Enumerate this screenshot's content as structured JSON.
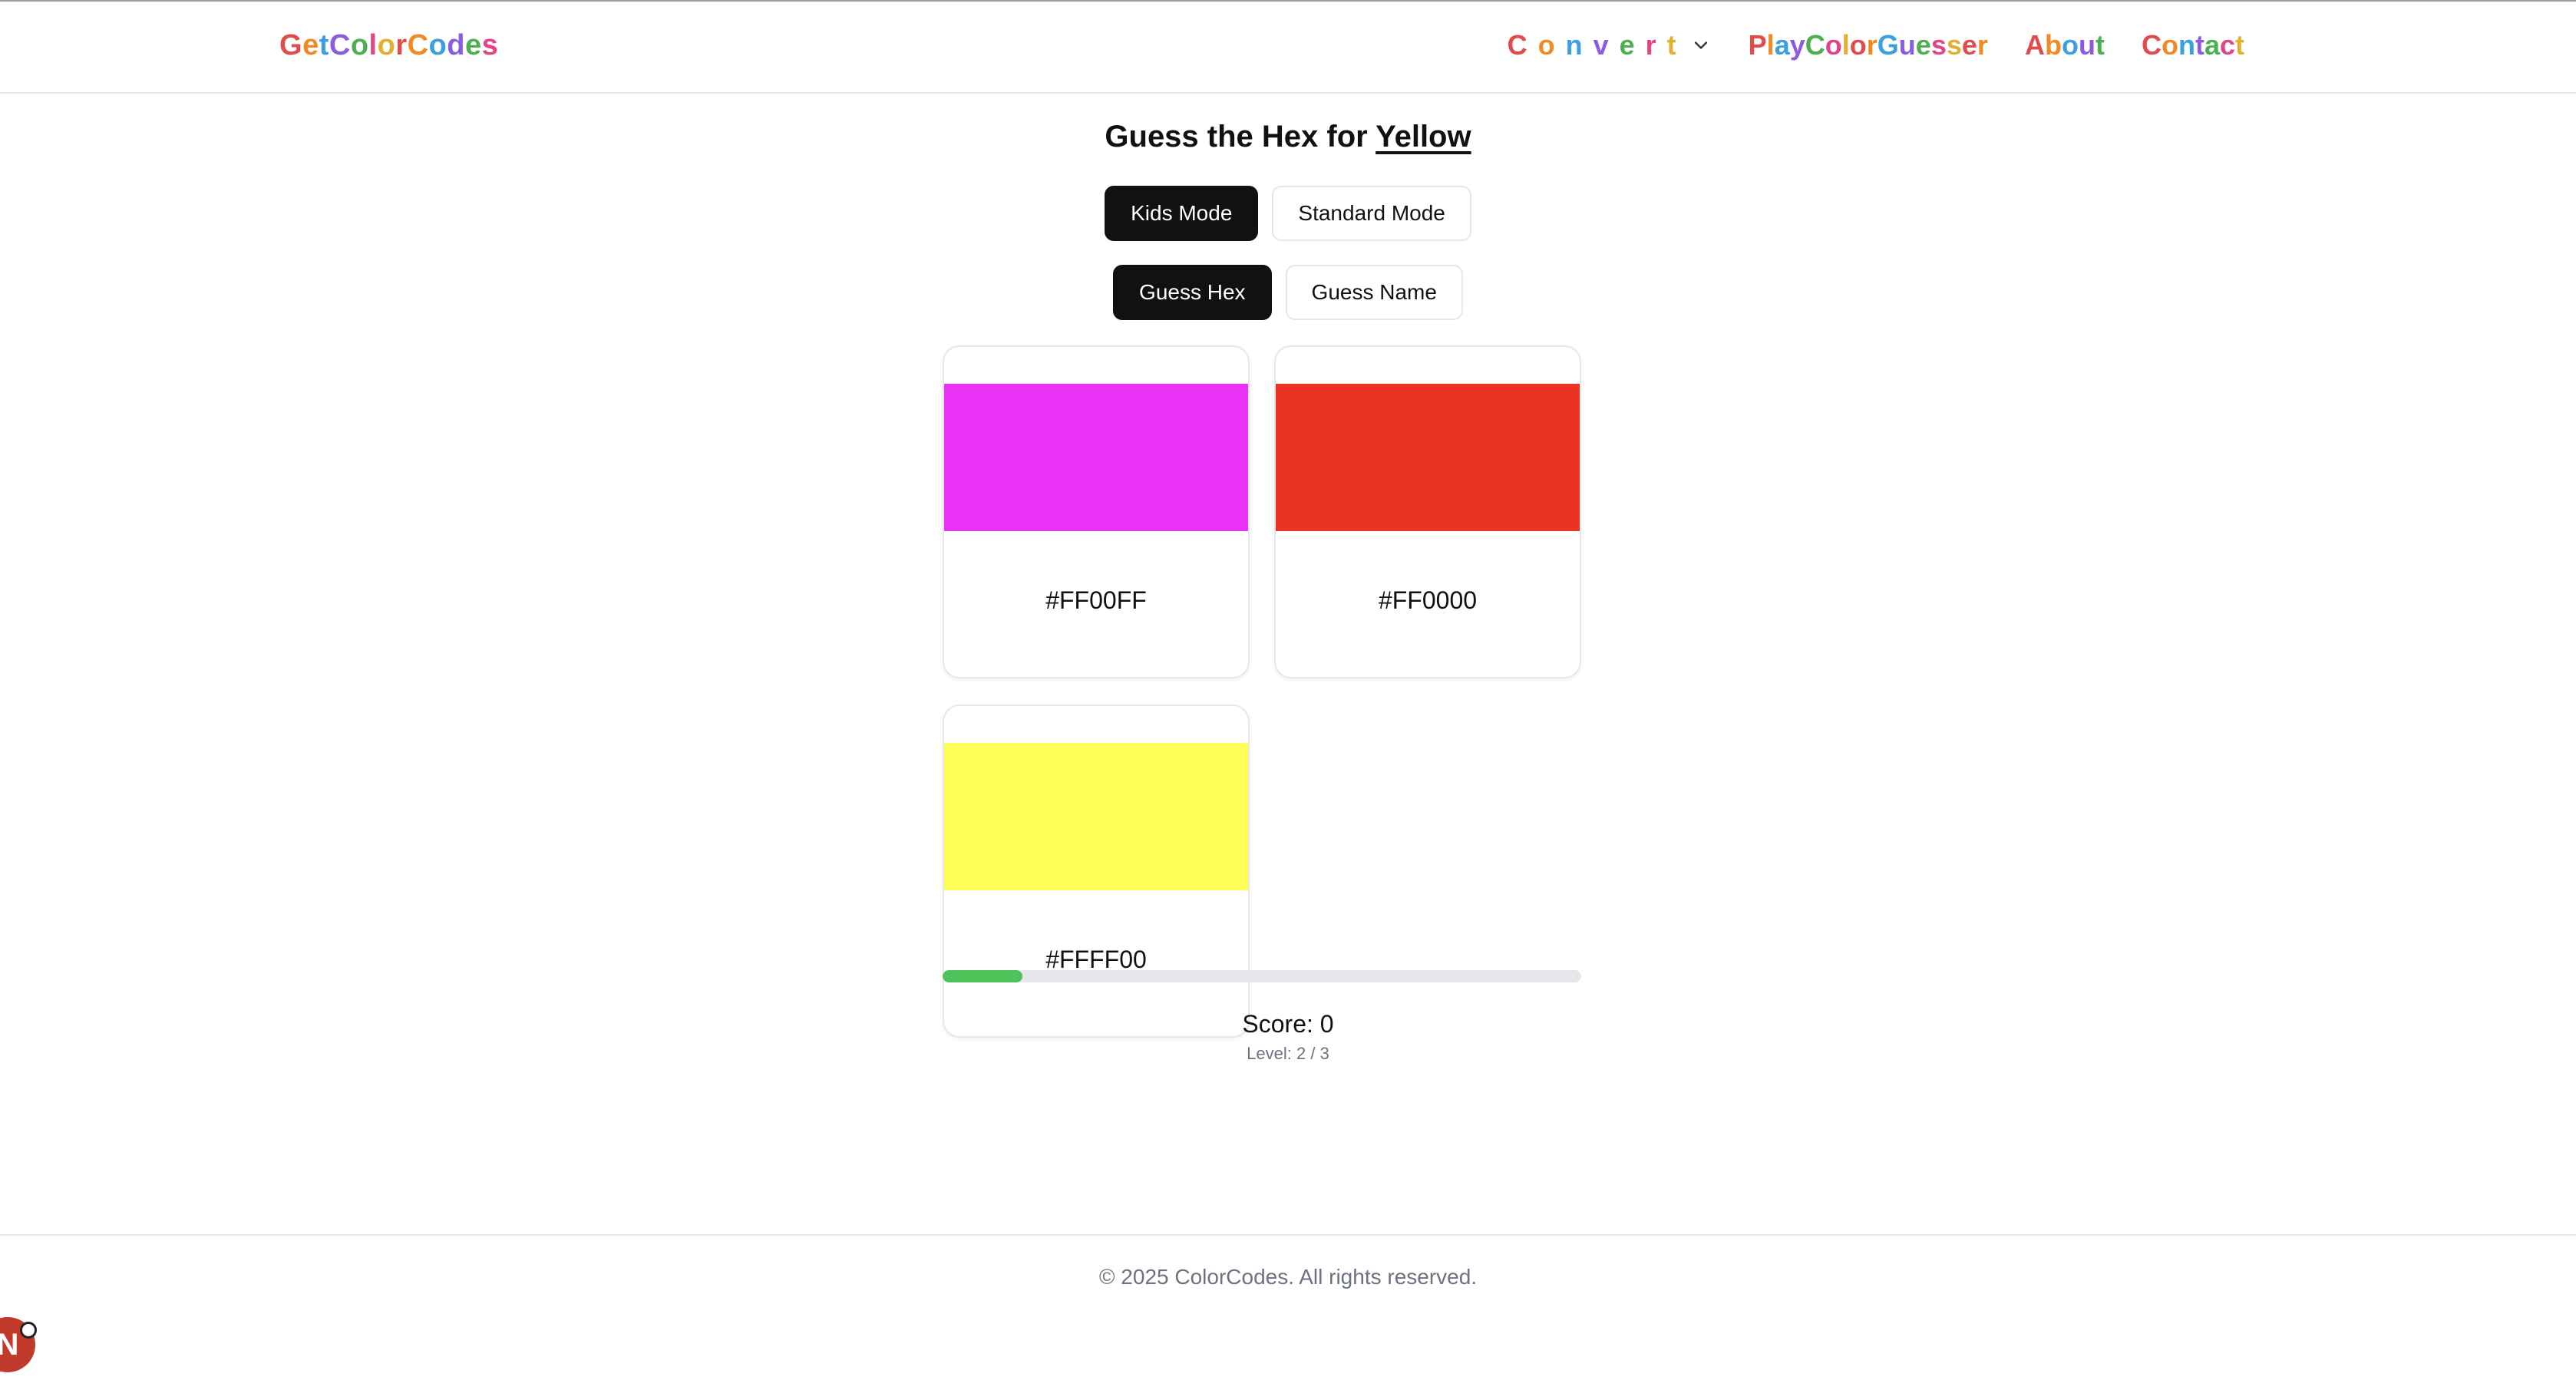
{
  "header": {
    "logo": "GetColorCodes",
    "nav": {
      "convert": "Convert",
      "play": "PlayColorGuesser",
      "about": "About",
      "contact": "Contact"
    }
  },
  "game": {
    "title_prefix": "Guess the Hex for",
    "target_color": "Yellow",
    "mode_buttons": {
      "kids": "Kids Mode",
      "standard": "Standard Mode"
    },
    "guess_buttons": {
      "hex": "Guess Hex",
      "name": "Guess Name"
    },
    "options": [
      {
        "hex": "#FF00FF",
        "swatch": "#ea33f7"
      },
      {
        "hex": "#FF0000",
        "swatch": "#ea3323"
      },
      {
        "hex": "#FFFF00",
        "swatch": "#ffff55"
      }
    ],
    "progress_fraction": 0.125,
    "progress_color": "#4cc45a",
    "score_text": "Score: 0",
    "level_text": "Level: 2 / 3"
  },
  "footer": {
    "copyright": "© 2025 ColorCodes. All rights reserved."
  },
  "dev_badge": "N",
  "colors": {
    "rainbow": [
      "#e04c4c",
      "#f08a24",
      "#3aa0e0",
      "#8c5ce0",
      "#4cb050",
      "#e0458a",
      "#e0b030"
    ],
    "active_button": "#111111"
  }
}
